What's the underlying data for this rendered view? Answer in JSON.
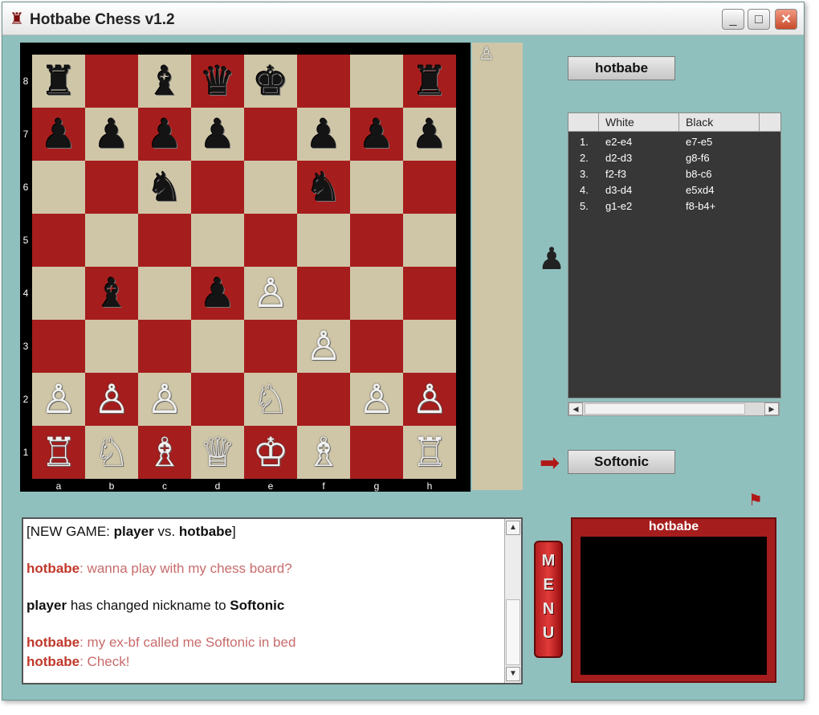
{
  "window": {
    "title": "Hotbabe Chess v1.2",
    "minimize_glyph": "_",
    "maximize_glyph": "□",
    "close_glyph": "✕"
  },
  "board": {
    "ranks": [
      "8",
      "7",
      "6",
      "5",
      "4",
      "3",
      "2",
      "1"
    ],
    "files": [
      "a",
      "b",
      "c",
      "d",
      "e",
      "f",
      "g",
      "h"
    ],
    "colors": {
      "light": "#cfc6a8",
      "dark": "#a61d1d"
    },
    "pieces": [
      {
        "square": "a8",
        "piece": "rook",
        "color": "black"
      },
      {
        "square": "c8",
        "piece": "bishop",
        "color": "black"
      },
      {
        "square": "d8",
        "piece": "queen",
        "color": "black"
      },
      {
        "square": "e8",
        "piece": "king",
        "color": "black"
      },
      {
        "square": "h8",
        "piece": "rook",
        "color": "black"
      },
      {
        "square": "a7",
        "piece": "pawn",
        "color": "black"
      },
      {
        "square": "b7",
        "piece": "pawn",
        "color": "black"
      },
      {
        "square": "c7",
        "piece": "pawn",
        "color": "black"
      },
      {
        "square": "d7",
        "piece": "pawn",
        "color": "black"
      },
      {
        "square": "f7",
        "piece": "pawn",
        "color": "black"
      },
      {
        "square": "g7",
        "piece": "pawn",
        "color": "black"
      },
      {
        "square": "h7",
        "piece": "pawn",
        "color": "black"
      },
      {
        "square": "c6",
        "piece": "knight",
        "color": "black"
      },
      {
        "square": "f6",
        "piece": "knight",
        "color": "black"
      },
      {
        "square": "b4",
        "piece": "bishop",
        "color": "black"
      },
      {
        "square": "d4",
        "piece": "pawn",
        "color": "black"
      },
      {
        "square": "e4",
        "piece": "pawn",
        "color": "white"
      },
      {
        "square": "f3",
        "piece": "pawn",
        "color": "white"
      },
      {
        "square": "a2",
        "piece": "pawn",
        "color": "white"
      },
      {
        "square": "b2",
        "piece": "pawn",
        "color": "white"
      },
      {
        "square": "c2",
        "piece": "pawn",
        "color": "white"
      },
      {
        "square": "e2",
        "piece": "knight",
        "color": "white"
      },
      {
        "square": "g2",
        "piece": "pawn",
        "color": "white"
      },
      {
        "square": "h2",
        "piece": "pawn",
        "color": "white"
      },
      {
        "square": "a1",
        "piece": "rook",
        "color": "white"
      },
      {
        "square": "b1",
        "piece": "knight",
        "color": "white"
      },
      {
        "square": "c1",
        "piece": "bishop",
        "color": "white"
      },
      {
        "square": "d1",
        "piece": "queen",
        "color": "white"
      },
      {
        "square": "e1",
        "piece": "king",
        "color": "white"
      },
      {
        "square": "f1",
        "piece": "bishop",
        "color": "white"
      },
      {
        "square": "h1",
        "piece": "rook",
        "color": "white"
      }
    ]
  },
  "captured": {
    "pieces": [
      {
        "piece": "pawn",
        "color": "white"
      }
    ]
  },
  "players": {
    "opponent": "hotbabe",
    "player": "Softonic",
    "turn_indicator_icon": "pawn-icon",
    "active_arrow_icon": "arrow-right-icon"
  },
  "moves": {
    "headers": [
      "",
      "White",
      "Black"
    ],
    "rows": [
      {
        "num": "1.",
        "white": "e2-e4",
        "black": "e7-e5"
      },
      {
        "num": "2.",
        "white": "d2-d3",
        "black": "g8-f6"
      },
      {
        "num": "3.",
        "white": "f2-f3",
        "black": "b8-c6"
      },
      {
        "num": "4.",
        "white": "d3-d4",
        "black": "e5xd4"
      },
      {
        "num": "5.",
        "white": "g1-e2",
        "black": "f8-b4+"
      }
    ]
  },
  "chat": {
    "line1": {
      "pre": "[NEW GAME: ",
      "p1": "player",
      "mid": " vs. ",
      "p2": "hotbabe",
      "post": "]"
    },
    "line2": {
      "nick": "hotbabe",
      "text": ": wanna play with my chess board?"
    },
    "line3": {
      "name": "player",
      "text": " has changed nickname to ",
      "newname": "Softonic"
    },
    "line4": {
      "nick": "hotbabe",
      "text": ": my ex-bf called me Softonic in bed"
    },
    "line5": {
      "nick": "hotbabe",
      "text": ": Check!"
    }
  },
  "menu": {
    "label": "MENU"
  },
  "video": {
    "title": "hotbabe"
  },
  "icons": {
    "flag": "flag-icon",
    "app": "chess-rook-icon"
  }
}
